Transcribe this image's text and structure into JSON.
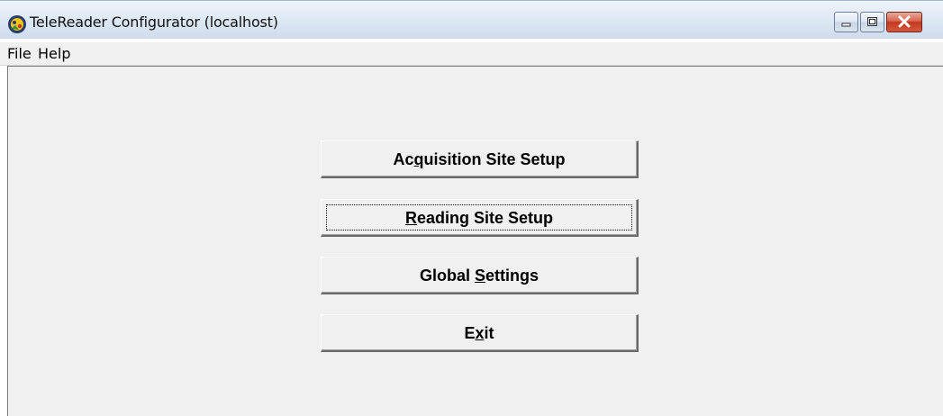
{
  "window": {
    "title": "TeleReader Configurator (localhost)",
    "icon": "telereader-app-icon"
  },
  "titlebar_controls": {
    "minimize_icon": "minimize-icon",
    "maximize_icon": "maximize-icon",
    "close_icon": "close-icon",
    "close_color": "#c2391f"
  },
  "menu": {
    "items": [
      "File",
      "Help"
    ]
  },
  "buttons": [
    {
      "pre": "Ac",
      "mnemonic": "q",
      "post": "uisition Site Setup",
      "full": "Acquisition Site Setup"
    },
    {
      "pre": "",
      "mnemonic": "R",
      "post": "eading Site Setup",
      "full": "Reading Site Setup",
      "focused": true
    },
    {
      "pre": "Global ",
      "mnemonic": "S",
      "post": "ettings",
      "full": "Global Settings"
    },
    {
      "pre": "E",
      "mnemonic": "x",
      "post": "it",
      "full": "Exit"
    }
  ]
}
